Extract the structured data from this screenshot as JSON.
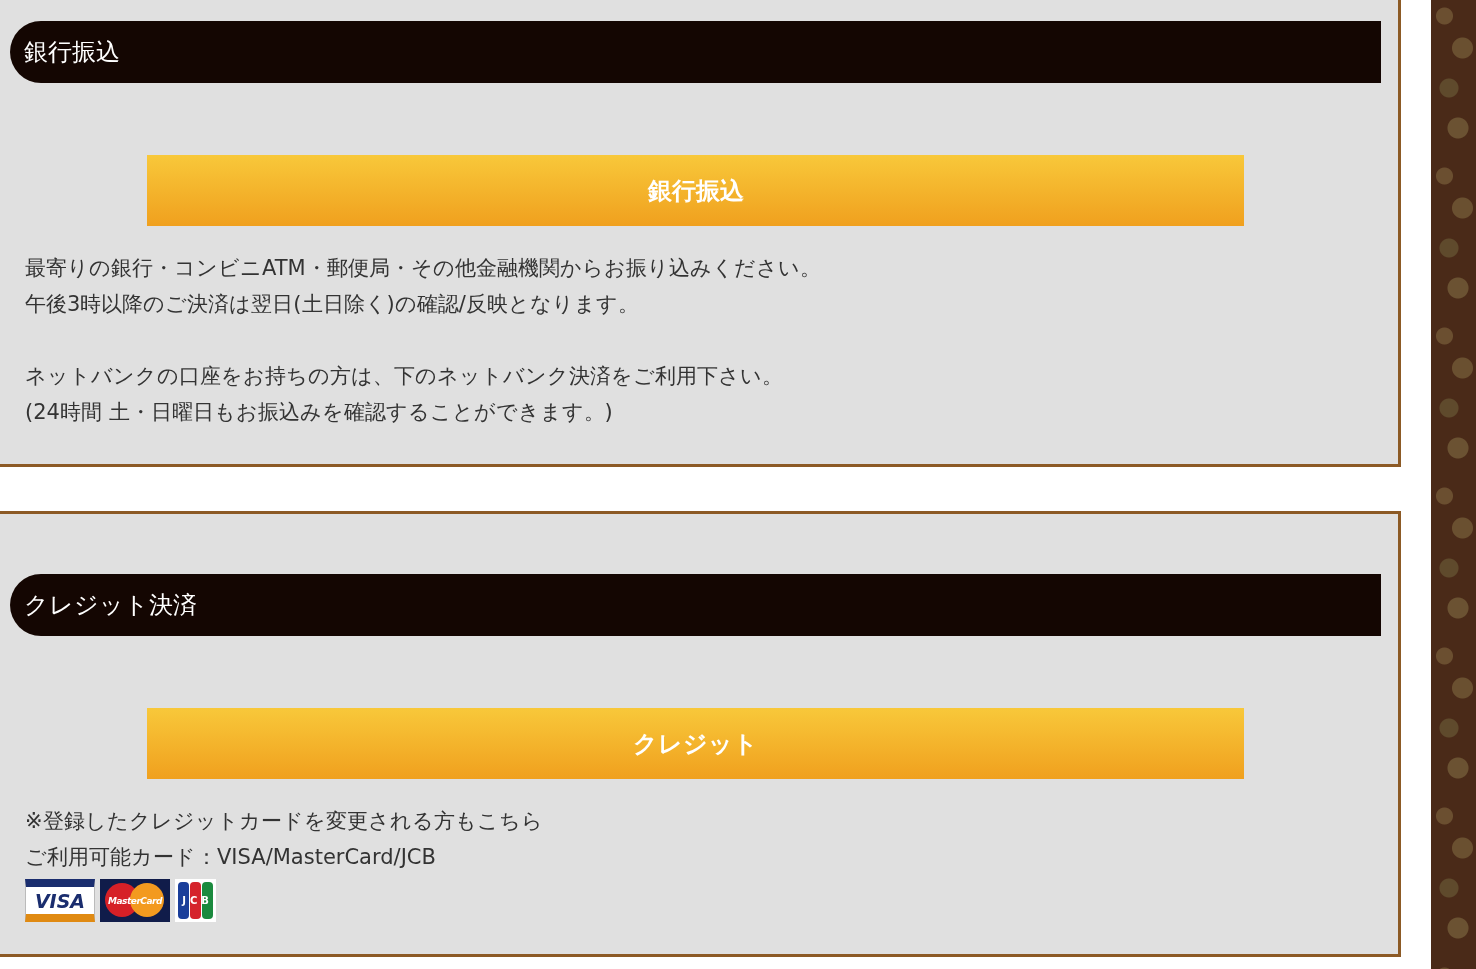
{
  "sections": [
    {
      "title": "銀行振込",
      "button": "銀行振込",
      "paragraphs": [
        [
          "最寄りの銀行・コンビニATM・郵便局・その他金融機関からお振り込みください。",
          "午後3時以降のご決済は翌日(土日除く)の確認/反映となります。"
        ],
        [
          "ネットバンクの口座をお持ちの方は、下のネットバンク決済をご利用下さい。",
          "(24時間 土・日曜日もお振込みを確認することができます。)"
        ]
      ]
    },
    {
      "title": "クレジット決済",
      "button": "クレジット",
      "paragraphs": [
        [
          "※登録したクレジットカードを変更される方もこちら",
          "ご利用可能カード：VISA/MasterCard/JCB"
        ]
      ],
      "card_logos": [
        {
          "kind": "visa",
          "label": "VISA"
        },
        {
          "kind": "mastercard",
          "label": "MasterCard"
        },
        {
          "kind": "jcb",
          "label": "JCB"
        }
      ]
    }
  ]
}
